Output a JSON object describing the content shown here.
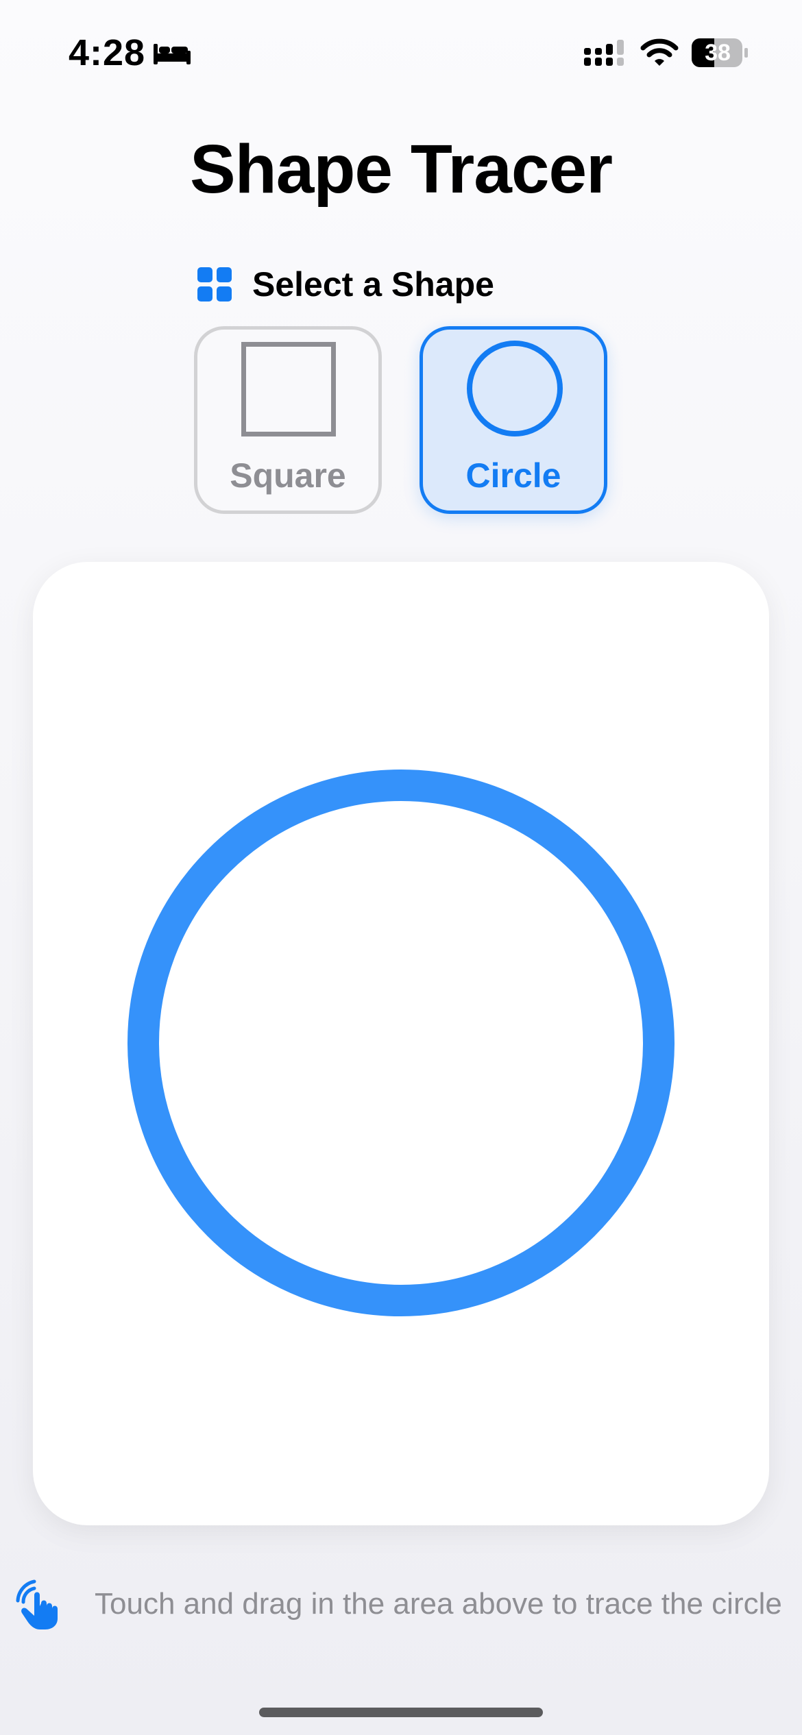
{
  "status_bar": {
    "time": "4:28",
    "battery_level": "38",
    "icons": [
      "bed-icon",
      "signal-icon",
      "wifi-icon",
      "battery-icon"
    ]
  },
  "page": {
    "title": "Shape Tracer"
  },
  "selector": {
    "label": "Select a Shape",
    "icon": "grid-icon",
    "options": [
      {
        "label": "Square",
        "icon": "square-shape-icon",
        "selected": false
      },
      {
        "label": "Circle",
        "icon": "circle-shape-icon",
        "selected": true
      }
    ]
  },
  "canvas": {
    "target_shape": "circle"
  },
  "instruction": {
    "icon": "hand-tap-icon",
    "text": "Touch and drag in the area above to trace the circle"
  },
  "colors": {
    "accent": "#137cf3",
    "trace_stroke": "#3592fa",
    "inactive": "#8e8e93",
    "selected_bg": "#dce9fb"
  }
}
